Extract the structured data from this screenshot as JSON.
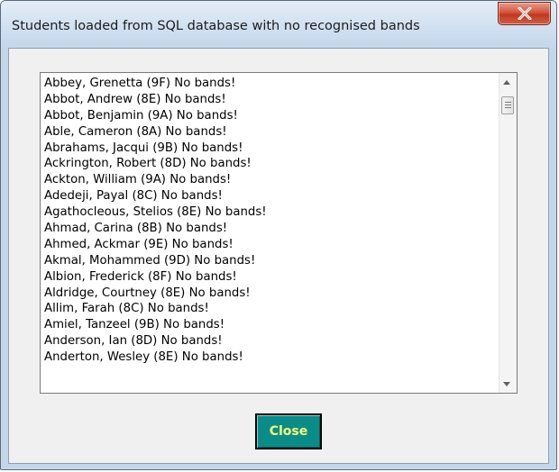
{
  "window": {
    "title": "Students loaded from SQL database with no recognised bands",
    "close_glyph": "X"
  },
  "list": {
    "items": [
      "Abbey, Grenetta (9F) No bands!",
      "Abbot, Andrew (8E) No bands!",
      "Abbot, Benjamin (9A) No bands!",
      "Able, Cameron (8A) No bands!",
      "Abrahams, Jacqui (9B) No bands!",
      "Ackrington, Robert (8D) No bands!",
      "Ackton, William (9A) No bands!",
      "Adedeji, Payal (8C) No bands!",
      "Agathocleous, Stelios (8E) No bands!",
      "Ahmad, Carina (8B) No bands!",
      "Ahmed, Ackmar (9E) No bands!",
      "Akmal, Mohammed (9D) No bands!",
      "Albion, Frederick (8F) No bands!",
      "Aldridge, Courtney (8E) No bands!",
      "Allim, Farah (8C) No bands!",
      "Amiel, Tanzeel (9B) No bands!",
      "Anderson, Ian (8D) No bands!",
      "Anderton, Wesley (8E) No bands!"
    ]
  },
  "buttons": {
    "close_label": "Close"
  },
  "colors": {
    "button_bg": "#0a8c88",
    "button_text": "#f5ff7a",
    "titlebar_close": "#c2381f"
  },
  "icons": {
    "title_close": "close-icon",
    "scroll_up": "chevron-up-icon",
    "scroll_down": "chevron-down-icon",
    "scroll_thumb": "grip-icon"
  }
}
